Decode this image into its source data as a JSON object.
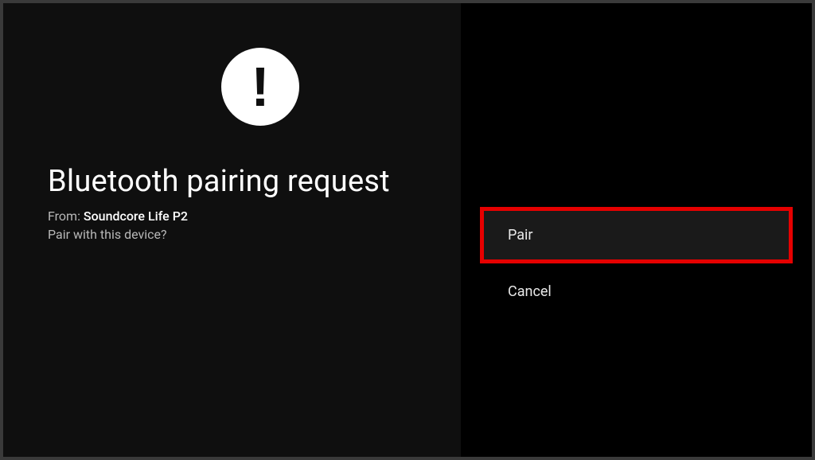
{
  "dialog": {
    "title": "Bluetooth pairing request",
    "from_label": "From: ",
    "from_device": "Soundcore Life P2",
    "question": "Pair with this device?"
  },
  "actions": {
    "pair": "Pair",
    "cancel": "Cancel"
  },
  "highlight_color": "#e60000"
}
